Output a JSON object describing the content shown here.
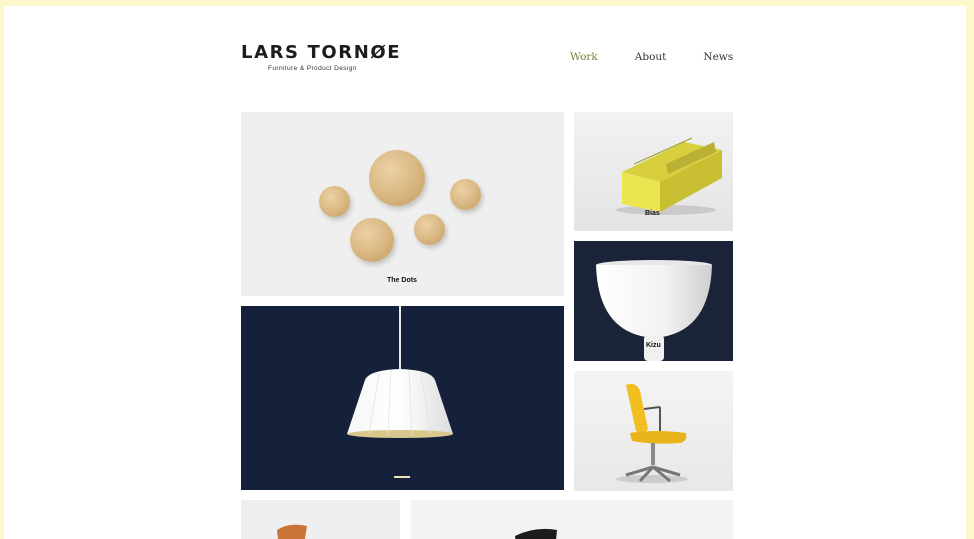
{
  "brand": {
    "name": "LARS TORNØE",
    "tagline": "Furniture & Product Design"
  },
  "nav": {
    "items": [
      {
        "label": "Work",
        "active": true
      },
      {
        "label": "About",
        "active": false
      },
      {
        "label": "News",
        "active": false
      }
    ]
  },
  "colors": {
    "page_background": "#fdf8cc",
    "nav_active": "#7e7a36",
    "navy": "#15203a",
    "bench_yellow": "#e8e04a",
    "chair_yellow": "#f1be21"
  },
  "projects": [
    {
      "label": "The Dots"
    },
    {
      "label": "Bias"
    },
    {
      "label": "Kizu"
    },
    {
      "label": ""
    },
    {
      "label": ""
    }
  ]
}
